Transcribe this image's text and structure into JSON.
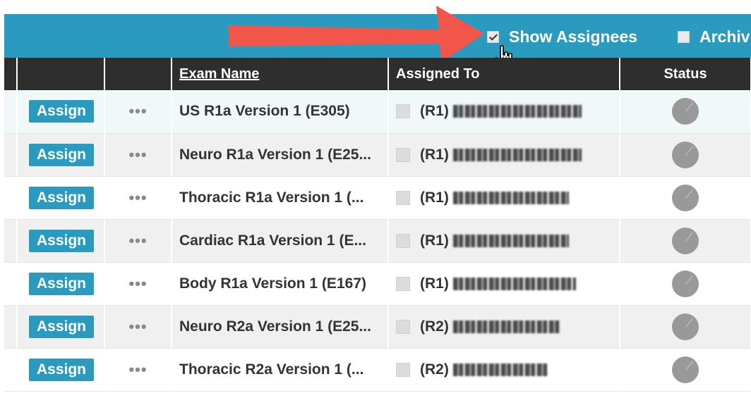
{
  "toolbar": {
    "show_assignees": {
      "label": "Show Assignees",
      "checked": true
    },
    "archived": {
      "label": "Archiv",
      "checked": false
    }
  },
  "annotation": {
    "arrow_color": "#f2554a",
    "cursor": "hand-pointer-icon"
  },
  "table": {
    "columns": {
      "exam_name": "Exam Name",
      "assigned_to": "Assigned To",
      "status": "Status"
    },
    "rows": [
      {
        "action": "Assign",
        "more": "•••",
        "exam": "US R1a Version 1 (E305)",
        "level": "(R1)"
      },
      {
        "action": "Assign",
        "more": "•••",
        "exam": "Neuro R1a Version 1 (E25...",
        "level": "(R1)"
      },
      {
        "action": "Assign",
        "more": "•••",
        "exam": "Thoracic R1a Version 1 (...",
        "level": "(R1)"
      },
      {
        "action": "Assign",
        "more": "•••",
        "exam": "Cardiac R1a Version 1 (E...",
        "level": "(R1)"
      },
      {
        "action": "Assign",
        "more": "•••",
        "exam": "Body R1a Version 1 (E167)",
        "level": "(R1)"
      },
      {
        "action": "Assign",
        "more": "•••",
        "exam": "Neuro R2a Version 1 (E25...",
        "level": "(R2)"
      },
      {
        "action": "Assign",
        "more": "•••",
        "exam": "Thoracic R2a Version 1 (...",
        "level": "(R2)"
      }
    ]
  },
  "colors": {
    "accent": "#2a9bbf",
    "header_bg": "#2e2e2e",
    "status_icon": "#999999"
  }
}
